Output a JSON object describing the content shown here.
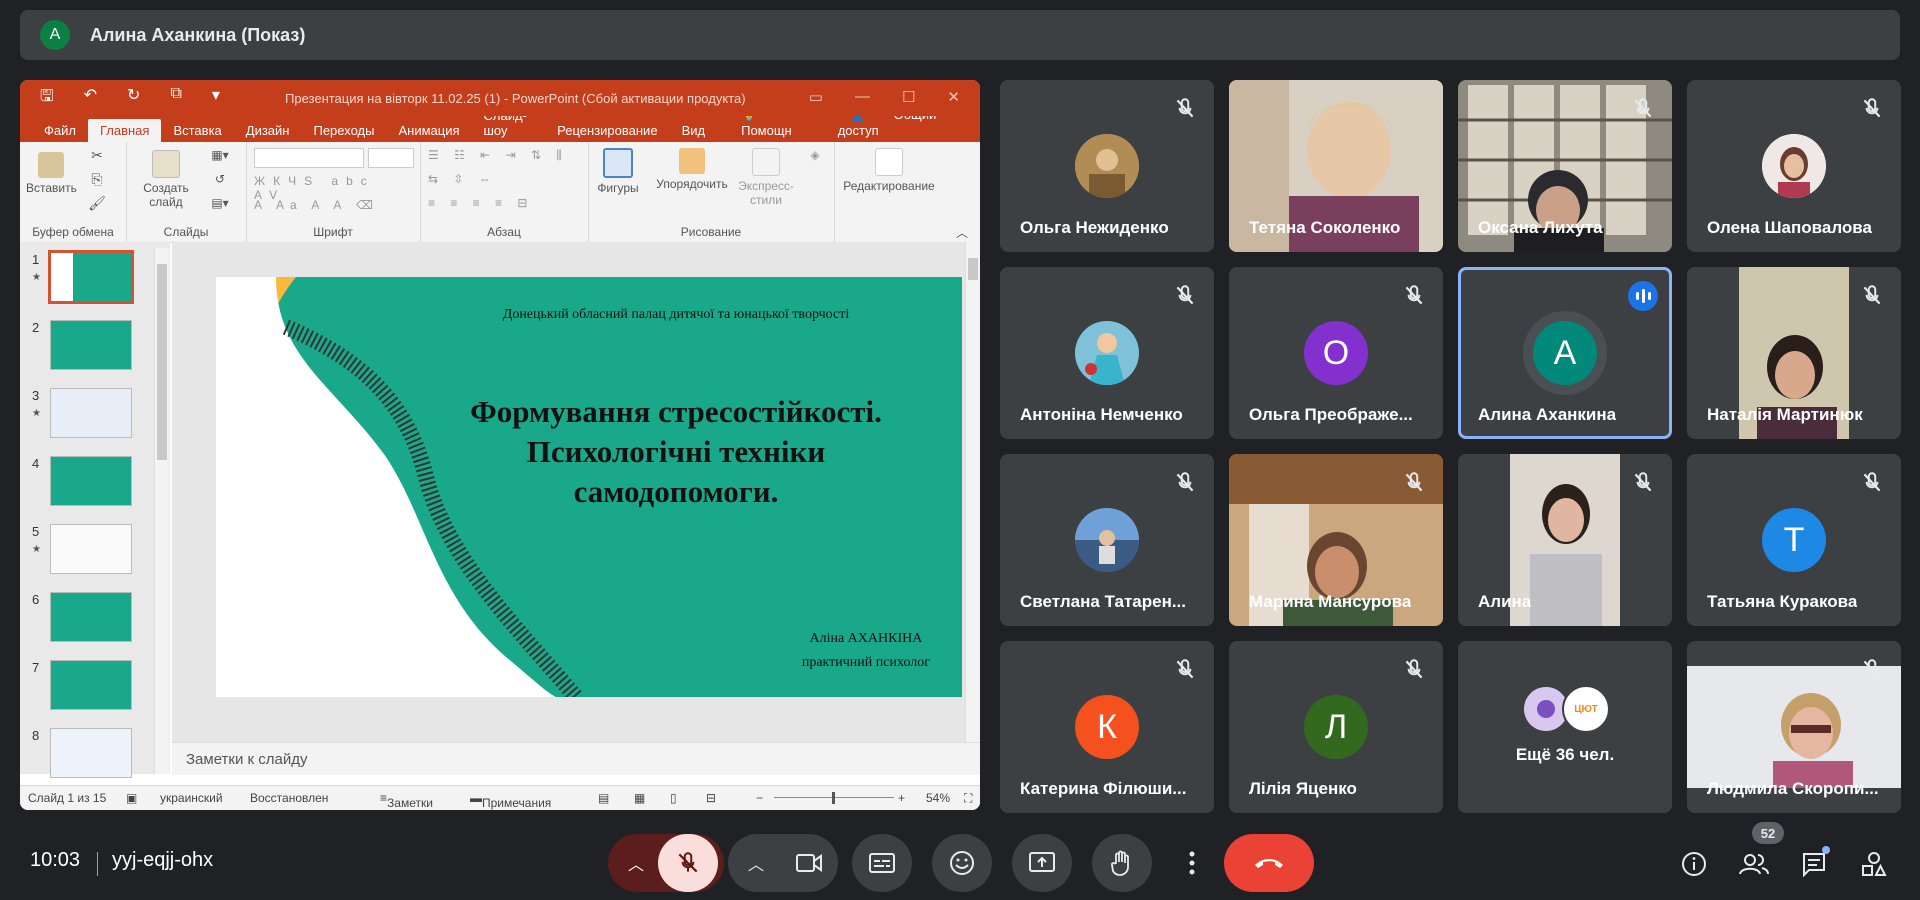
{
  "presenter": {
    "avatar_letter": "A",
    "title": "Алина Аханкина (Показ)"
  },
  "powerpoint": {
    "window_title": "Презентация на вівторк 11.02.25 (1) - PowerPoint (Сбой активации продукта)",
    "tabs": [
      "Файл",
      "Главная",
      "Вставка",
      "Дизайн",
      "Переходы",
      "Анимация",
      "Слайд-шоу",
      "Рецензирование",
      "Вид",
      "Помощн"
    ],
    "share_label": "Общий доступ",
    "groups": [
      "Буфер обмена",
      "Слайды",
      "Шрифт",
      "Абзац",
      "Рисование"
    ],
    "buttons": {
      "paste": "Вставить",
      "create_slide": "Создать слайд",
      "shapes": "Фигуры",
      "arrange": "Упорядочить",
      "quick_styles": "Экспресс-стили",
      "editing": "Редактирование"
    },
    "thumbnails": [
      "1",
      "2",
      "3",
      "4",
      "5",
      "6",
      "7",
      "8"
    ],
    "slide": {
      "org": "Донецький обласний палац дитячої та юнацької творчості",
      "title": "Формування стресостійкості. Психологічні техніки самодопомоги.",
      "author": "Аліна АХАНКІНА",
      "role": "практичний психолог"
    },
    "notes_placeholder": "Заметки к слайду",
    "status": {
      "slide": "Слайд 1 из 15",
      "language": "украинский",
      "recovered": "Восстановлен",
      "notes": "Заметки",
      "comments": "Примечания",
      "zoom": "54%"
    }
  },
  "participants": [
    {
      "name": "Ольга Нежиденко",
      "type": "photo",
      "color": "#c8a46a"
    },
    {
      "name": "Тетяна Соколенко",
      "type": "video"
    },
    {
      "name": "Оксана Лихута",
      "type": "video"
    },
    {
      "name": "Олена Шаповалова",
      "type": "photo",
      "color": "#d8b7a0"
    },
    {
      "name": "Антоніна Немченко",
      "type": "photo",
      "color": "#5fb1c9"
    },
    {
      "name": "Ольга Преображе...",
      "type": "letter",
      "letter": "О",
      "color": "#8430ce"
    },
    {
      "name": "Алина Аханкина",
      "type": "letter",
      "letter": "A",
      "color": "#00897b"
    },
    {
      "name": "Наталія Мартинюк",
      "type": "video"
    },
    {
      "name": "Светлана Татарен...",
      "type": "photo",
      "color": "#5a7fb0"
    },
    {
      "name": "Марина Мансурова",
      "type": "video"
    },
    {
      "name": "Алина",
      "type": "video"
    },
    {
      "name": "Татьяна Куракова",
      "type": "letter",
      "letter": "Т",
      "color": "#1e88e5"
    },
    {
      "name": "Катерина Філюши...",
      "type": "letter",
      "letter": "К",
      "color": "#f4511e"
    },
    {
      "name": "Лілія Яценко",
      "type": "letter",
      "letter": "Л",
      "color": "#33691e"
    },
    {
      "name": "Ещё 36 чел.",
      "type": "more",
      "badge": "ЦЮТ"
    },
    {
      "name": "Людмила Скоропи...",
      "type": "video"
    }
  ],
  "meeting": {
    "time": "10:03",
    "code": "yyj-eqjj-ohx",
    "people_count": "52"
  },
  "colors": {
    "bg": "#202124",
    "tile": "#3c4043",
    "ppt_red": "#c43e1c",
    "teal": "#1aa88a",
    "yellow": "#fbb83f",
    "hangup": "#ea4335"
  }
}
